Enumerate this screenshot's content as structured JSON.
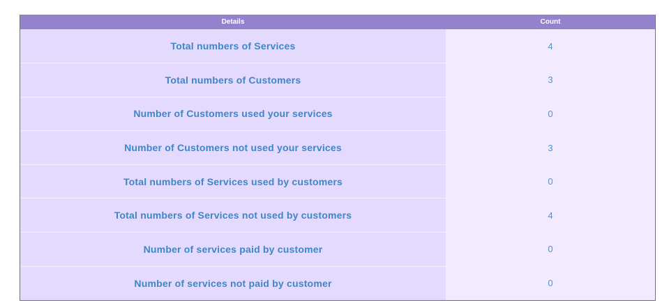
{
  "table": {
    "headers": {
      "details": "Details",
      "count": "Count"
    },
    "rows": [
      {
        "detail": "Total numbers of Services",
        "count": "4"
      },
      {
        "detail": "Total numbers of Customers",
        "count": "3"
      },
      {
        "detail": "Number of Customers used your services",
        "count": "0"
      },
      {
        "detail": "Number of Customers not used your services",
        "count": "3"
      },
      {
        "detail": "Total numbers of Services used by customers",
        "count": "0"
      },
      {
        "detail": "Total numbers of Services not used by customers",
        "count": "4"
      },
      {
        "detail": "Number of services paid by customer",
        "count": "0"
      },
      {
        "detail": "Number of services not paid by customer",
        "count": "0"
      }
    ]
  },
  "colors": {
    "header_bg": "#9483cc",
    "detail_bg": "#e4dafd",
    "count_bg": "#f2eafe",
    "text": "#3f86c8"
  }
}
